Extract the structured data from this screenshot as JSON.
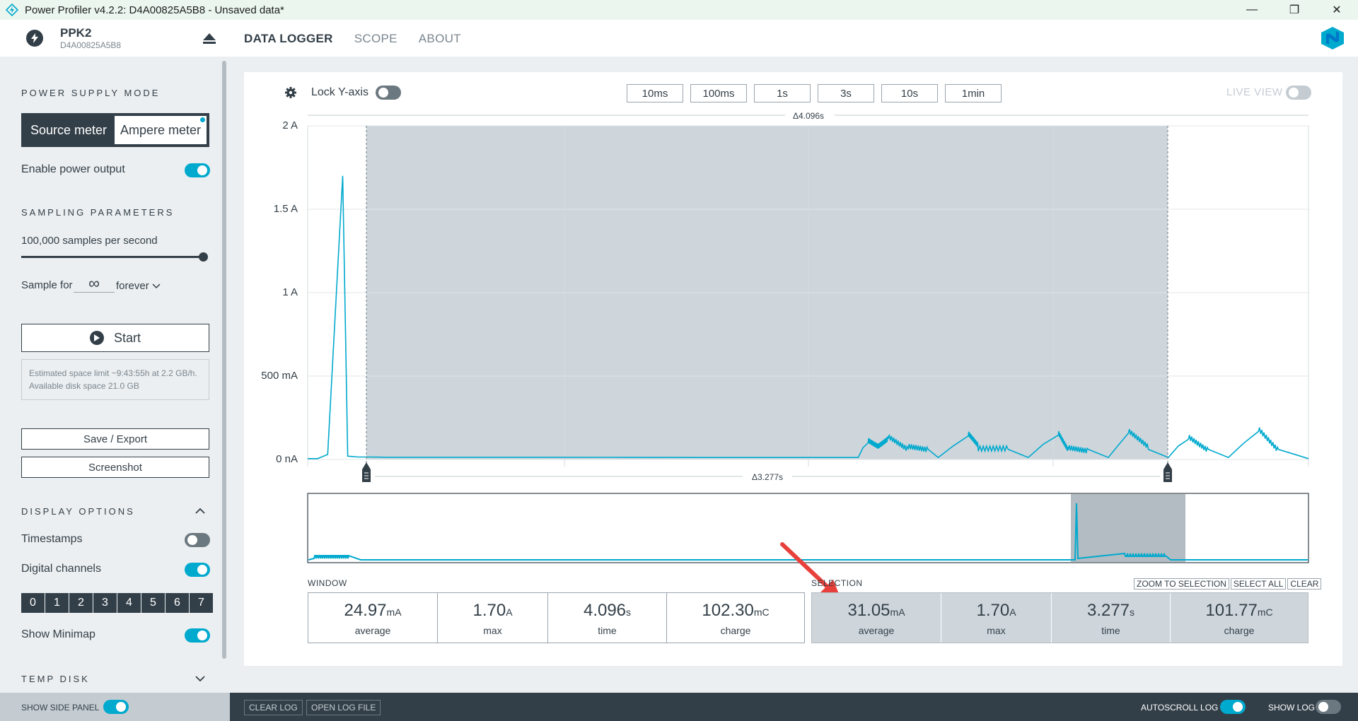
{
  "window": {
    "title": "Power Profiler v4.2.2: D4A00825A5B8 - Unsaved data*"
  },
  "device": {
    "name": "PPK2",
    "serial": "D4A00825A5B8"
  },
  "nav": [
    {
      "label": "DATA LOGGER",
      "active": true
    },
    {
      "label": "SCOPE",
      "active": false
    },
    {
      "label": "ABOUT",
      "active": false
    }
  ],
  "sidebar": {
    "power_mode_title": "POWER SUPPLY MODE",
    "mode_source": "Source meter",
    "mode_ampere": "Ampere meter",
    "enable_power": "Enable power output",
    "sampling_title": "SAMPLING PARAMETERS",
    "samples_label": "100,000 samples per second",
    "sample_for": "Sample for",
    "sample_value": "∞",
    "forever": "forever",
    "start": "Start",
    "estimate": "Estimated space limit ~9:43:55h at 2.2 GB/h. Available disk space 21.0 GB",
    "save_export": "Save / Export",
    "screenshot": "Screenshot",
    "display_title": "DISPLAY OPTIONS",
    "timestamps": "Timestamps",
    "digital_channels": "Digital channels",
    "channels": [
      "0",
      "1",
      "2",
      "3",
      "4",
      "5",
      "6",
      "7"
    ],
    "show_minimap": "Show Minimap",
    "temp_disk": "TEMP DISK",
    "show_side_panel": "SHOW SIDE PANEL"
  },
  "toolbar": {
    "lock_y": "Lock Y-axis",
    "windows": [
      "10ms",
      "100ms",
      "1s",
      "3s",
      "10s",
      "1min"
    ],
    "live_view": "LIVE VIEW"
  },
  "chart_data": {
    "type": "line",
    "yticks": [
      "2 A",
      "1.5 A",
      "1 A",
      "500 mA",
      "0 nA"
    ],
    "ylim": [
      0,
      2
    ],
    "window_delta": "Δ4.096s",
    "selection_delta": "Δ3.277s",
    "series": [
      {
        "x": [
          0,
          0.01,
          0.02,
          0.035,
          0.04,
          0.05,
          0.06,
          0.08,
          0.2,
          0.4,
          0.55,
          0.56,
          0.57,
          0.58,
          0.6,
          0.62,
          0.63,
          0.66,
          0.67,
          0.7,
          0.72,
          0.75,
          0.76,
          0.78,
          0.8,
          0.82,
          0.84,
          0.86,
          0.88,
          0.9,
          0.92,
          0.95,
          0.97,
          1.0
        ],
        "y": [
          0.005,
          0.005,
          0.03,
          1.7,
          0.02,
          0.015,
          0.015,
          0.013,
          0.013,
          0.012,
          0.012,
          0.13,
          0.09,
          0.14,
          0.07,
          0.06,
          0.012,
          0.15,
          0.07,
          0.06,
          0.012,
          0.17,
          0.07,
          0.06,
          0.012,
          0.16,
          0.06,
          0.012,
          0.15,
          0.06,
          0.012,
          0.18,
          0.06,
          0.005
        ]
      }
    ]
  },
  "stats": {
    "window_title": "WINDOW",
    "selection_title": "SELECTION",
    "window": [
      {
        "value": "24.97",
        "unit": "mA",
        "label": "average"
      },
      {
        "value": "1.70",
        "unit": "A",
        "label": "max"
      },
      {
        "value": "4.096",
        "unit": "s",
        "label": "time"
      },
      {
        "value": "102.30",
        "unit": "mC",
        "label": "charge"
      }
    ],
    "selection": [
      {
        "value": "31.05",
        "unit": "mA",
        "label": "average"
      },
      {
        "value": "1.70",
        "unit": "A",
        "label": "max"
      },
      {
        "value": "3.277",
        "unit": "s",
        "label": "time"
      },
      {
        "value": "101.77",
        "unit": "mC",
        "label": "charge"
      }
    ],
    "zoom_to_selection": "ZOOM TO SELECTION",
    "select_all": "SELECT ALL",
    "clear": "CLEAR"
  },
  "bottom": {
    "clear_log": "CLEAR LOG",
    "open_log": "OPEN LOG FILE",
    "autoscroll": "AUTOSCROLL LOG",
    "show_log": "SHOW LOG"
  },
  "colors": {
    "accent": "#00a9ce",
    "dark": "#333f48",
    "selection": "#ced6dc",
    "arrow": "#e8403a"
  }
}
